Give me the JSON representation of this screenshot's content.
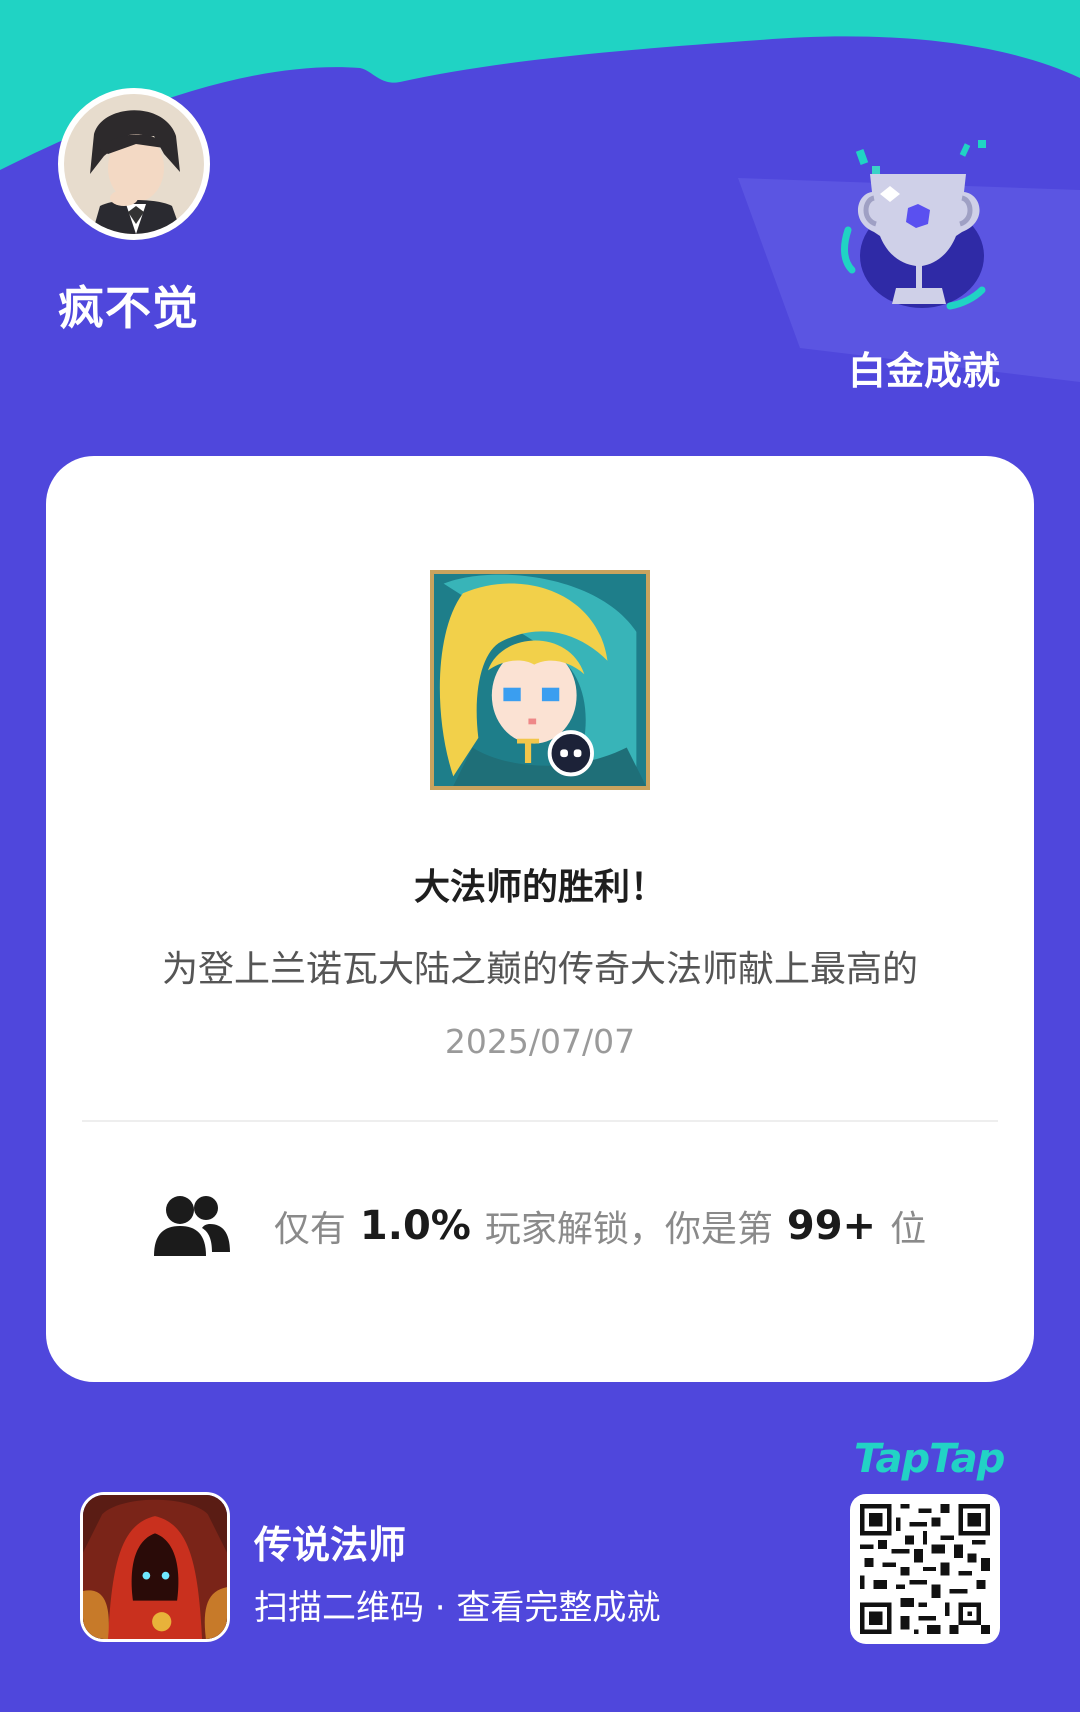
{
  "user": {
    "name": "疯不觉"
  },
  "badge": {
    "tier_label": "白金成就",
    "icon": "trophy-icon"
  },
  "achievement": {
    "title": "大法师的胜利！",
    "description": "为登上兰诺瓦大陆之巅的传奇大法师献上最高的",
    "date": "2025/07/07"
  },
  "stats": {
    "prefix": "仅有",
    "percent": "1.0%",
    "middle": "玩家解锁，你是第",
    "rank": "99+",
    "suffix": "位",
    "icon": "people-icon"
  },
  "game": {
    "name": "传说法师",
    "scan_hint": "扫描二维码 · 查看完整成就"
  },
  "brand": {
    "logo_text": "TapTap"
  },
  "colors": {
    "background": "#4f47dc",
    "accent_teal": "#20d3c4",
    "card": "#ffffff",
    "brand": "#22d3c5"
  }
}
